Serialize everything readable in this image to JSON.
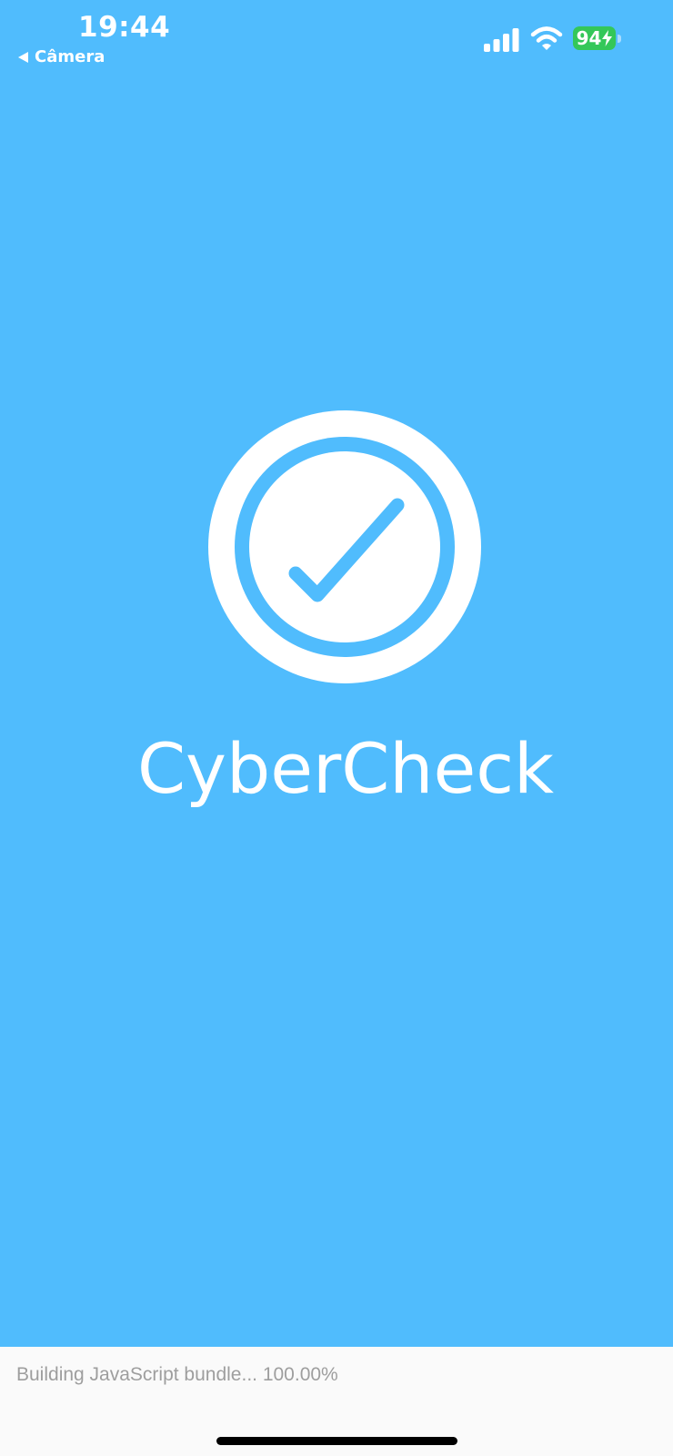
{
  "status_bar": {
    "time": "19:44",
    "back_app_label": "Câmera",
    "battery_level": "94",
    "icons": [
      "back-triangle-icon",
      "cellular-signal-icon",
      "wifi-icon",
      "battery-charging-icon"
    ]
  },
  "splash": {
    "app_name": "CyberCheck",
    "logo_icon": "checkmark-circle-icon",
    "background_color": "#50bcfd",
    "foreground_color": "#ffffff"
  },
  "dev_bundle": {
    "status_text": "Building JavaScript bundle... 100.00%",
    "progress_percent": 100
  }
}
